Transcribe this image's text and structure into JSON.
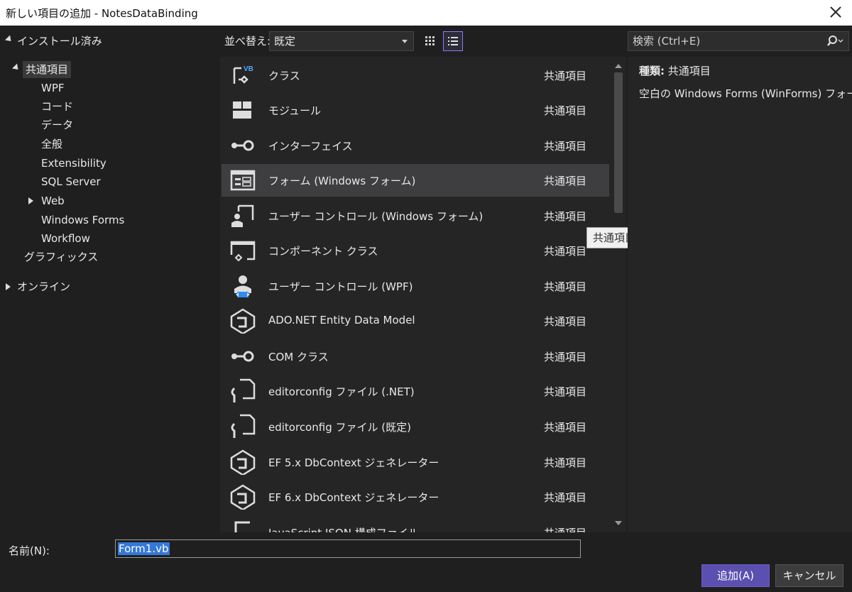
{
  "window": {
    "title": "新しい項目の追加 - NotesDataBinding"
  },
  "tree": {
    "installed": "インストール済み",
    "common": "共通項目",
    "children": [
      "WPF",
      "コード",
      "データ",
      "全般",
      "Extensibility",
      "SQL Server",
      "Web",
      "Windows Forms",
      "Workflow"
    ],
    "graphics": "グラフィックス",
    "online": "オンライン"
  },
  "toolbar": {
    "sort_label": "並べ替え:",
    "sort_value": "既定",
    "search_placeholder": "検索 (Ctrl+E)"
  },
  "items": [
    {
      "name": "クラス",
      "category": "共通項目",
      "icon": "vb-class-icon"
    },
    {
      "name": "モジュール",
      "category": "共通項目",
      "icon": "module-icon"
    },
    {
      "name": "インターフェイス",
      "category": "共通項目",
      "icon": "interface-icon"
    },
    {
      "name": "フォーム (Windows フォーム)",
      "category": "共通項目",
      "icon": "form-icon",
      "selected": true
    },
    {
      "name": "ユーザー コントロール (Windows フォーム)",
      "category": "共通項目",
      "icon": "user-control-icon"
    },
    {
      "name": "コンポーネント クラス",
      "category": "共通項目",
      "icon": "component-icon"
    },
    {
      "name": "ユーザー コントロール (WPF)",
      "category": "共通項目",
      "icon": "wpf-user-control-icon"
    },
    {
      "name": "ADO.NET Entity Data Model",
      "category": "共通項目",
      "icon": "entity-model-icon"
    },
    {
      "name": "COM クラス",
      "category": "共通項目",
      "icon": "com-class-icon"
    },
    {
      "name": "editorconfig ファイル (.NET)",
      "category": "共通項目",
      "icon": "config-file-icon"
    },
    {
      "name": "editorconfig ファイル (既定)",
      "category": "共通項目",
      "icon": "config-file-icon"
    },
    {
      "name": "EF 5.x DbContext ジェネレーター",
      "category": "共通項目",
      "icon": "ef-generator-icon"
    },
    {
      "name": "EF 6.x DbContext ジェネレーター",
      "category": "共通項目",
      "icon": "ef-generator-icon"
    },
    {
      "name": "JavaScript JSON 構成ファイル",
      "category": "共通項目",
      "icon": "json-file-icon"
    }
  ],
  "tooltip": "共通項目",
  "details": {
    "kind_label": "種類:",
    "kind_value": "共通項目",
    "description": "空白の Windows Forms (WinForms) フォーム"
  },
  "footer": {
    "name_label": "名前(N):",
    "name_value": "Form1.vb",
    "add_button": "追加(A)",
    "cancel_button": "キャンセル"
  },
  "colors": {
    "accent": "#5b4fb0",
    "selection": "#3478d8",
    "background": "#1f1f1f",
    "panel": "#252526"
  }
}
